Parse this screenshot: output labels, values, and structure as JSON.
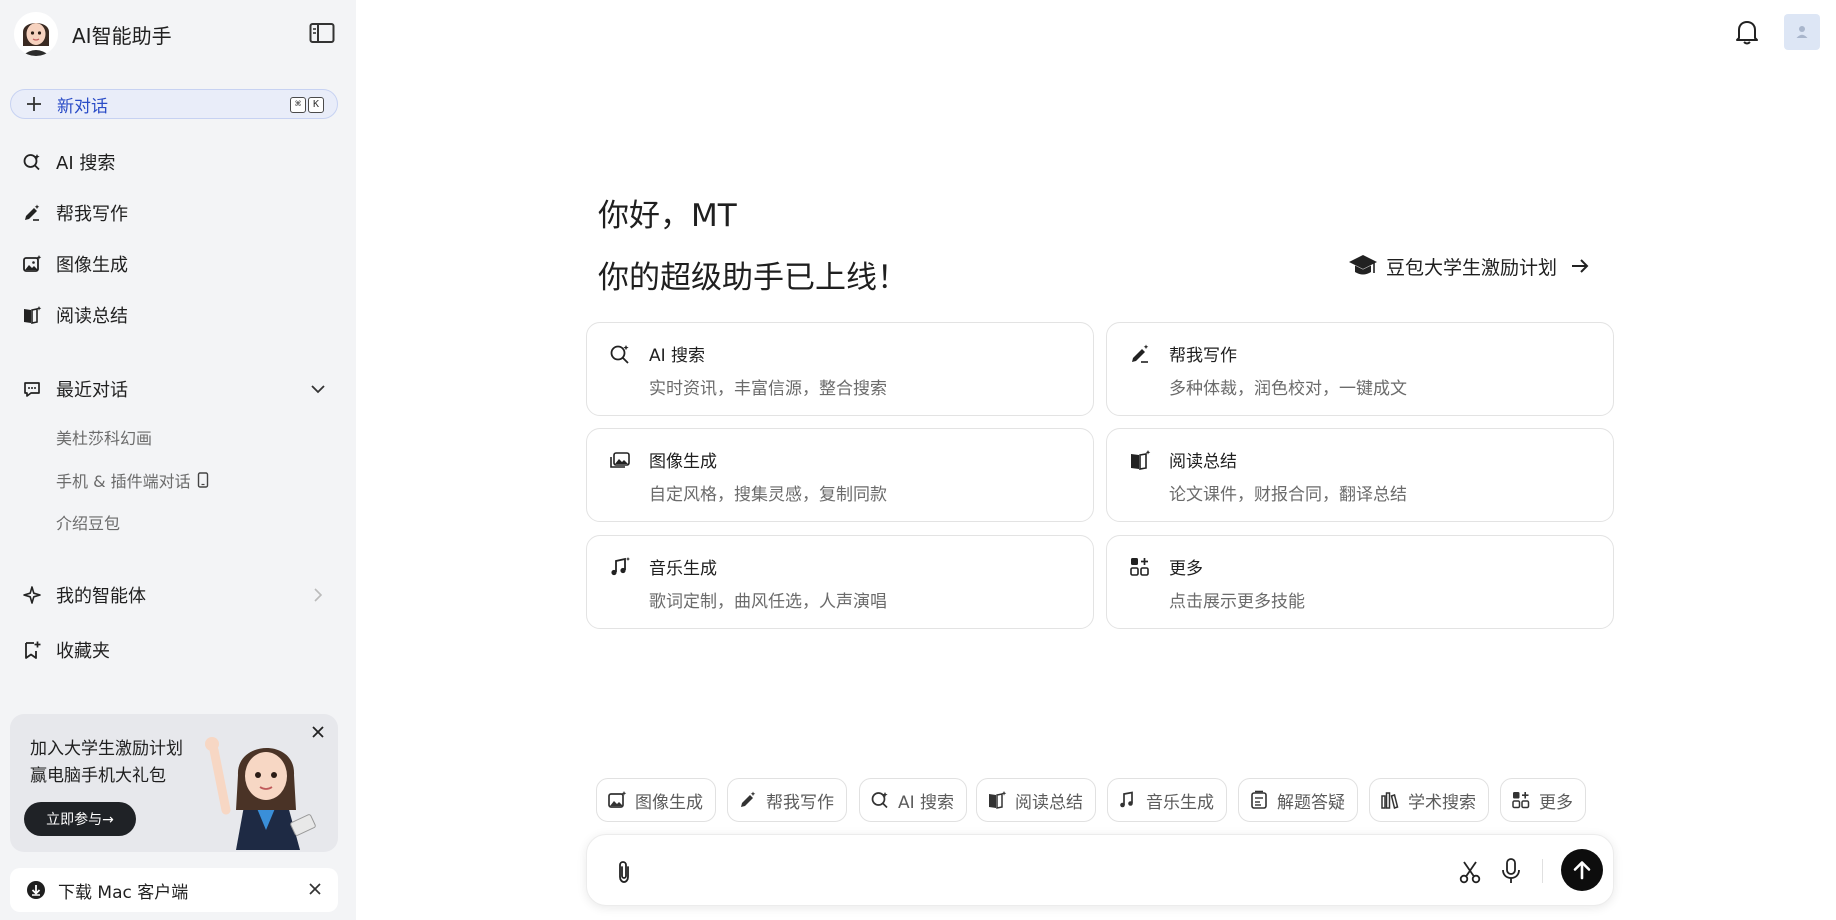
{
  "sidebar": {
    "brand_title": "AI智能助手",
    "new_chat": {
      "label": "新对话",
      "shortcut_mod": "⌘",
      "shortcut_key": "K"
    },
    "nav": [
      {
        "label": "AI 搜索",
        "icon": "ai-search-icon"
      },
      {
        "label": "帮我写作",
        "icon": "pen-sparkle-icon"
      },
      {
        "label": "图像生成",
        "icon": "image-sparkle-icon"
      },
      {
        "label": "阅读总结",
        "icon": "book-sparkle-icon"
      }
    ],
    "recent": {
      "label": "最近对话",
      "items": [
        "美杜莎科幻画",
        "手机 & 插件端对话",
        "介绍豆包"
      ]
    },
    "agents_label": "我的智能体",
    "favorites_label": "收藏夹",
    "promo": {
      "line1": "加入大学生激励计划",
      "line2": "赢电脑手机大礼包",
      "button": "立即参与→"
    },
    "download_label": "下载 Mac 客户端"
  },
  "main": {
    "greeting": "你好，MT",
    "subtitle": "你的超级助手已上线！",
    "campus_link": "豆包大学生激励计划",
    "cards": [
      {
        "title": "AI 搜索",
        "desc": "实时资讯，丰富信源，整合搜索",
        "icon": "ai-search-icon"
      },
      {
        "title": "帮我写作",
        "desc": "多种体裁，润色校对，一键成文",
        "icon": "pen-sparkle-icon"
      },
      {
        "title": "图像生成",
        "desc": "自定风格，搜集灵感，复制同款",
        "icon": "image-gallery-icon"
      },
      {
        "title": "阅读总结",
        "desc": "论文课件，财报合同，翻译总结",
        "icon": "book-sparkle-icon"
      },
      {
        "title": "音乐生成",
        "desc": "歌词定制，曲风任选，人声演唱",
        "icon": "music-note-icon"
      },
      {
        "title": "更多",
        "desc": "点击展示更多技能",
        "icon": "grid-plus-icon"
      }
    ],
    "chips": [
      {
        "label": "图像生成",
        "icon": "image-sparkle-icon"
      },
      {
        "label": "帮我写作",
        "icon": "pen-sparkle-icon"
      },
      {
        "label": "AI 搜索",
        "icon": "ai-search-icon"
      },
      {
        "label": "阅读总结",
        "icon": "book-sparkle-icon"
      },
      {
        "label": "音乐生成",
        "icon": "music-note-icon"
      },
      {
        "label": "解题答疑",
        "icon": "clipboard-formula-icon"
      },
      {
        "label": "学术搜索",
        "icon": "library-icon"
      },
      {
        "label": "更多",
        "icon": "grid-plus-icon"
      }
    ]
  },
  "colors": {
    "sidebar_bg": "#f3f4f6",
    "accent": "#2a4cc7",
    "new_chat_bg": "#e9edf9",
    "send_button": "#0d0d0d"
  }
}
